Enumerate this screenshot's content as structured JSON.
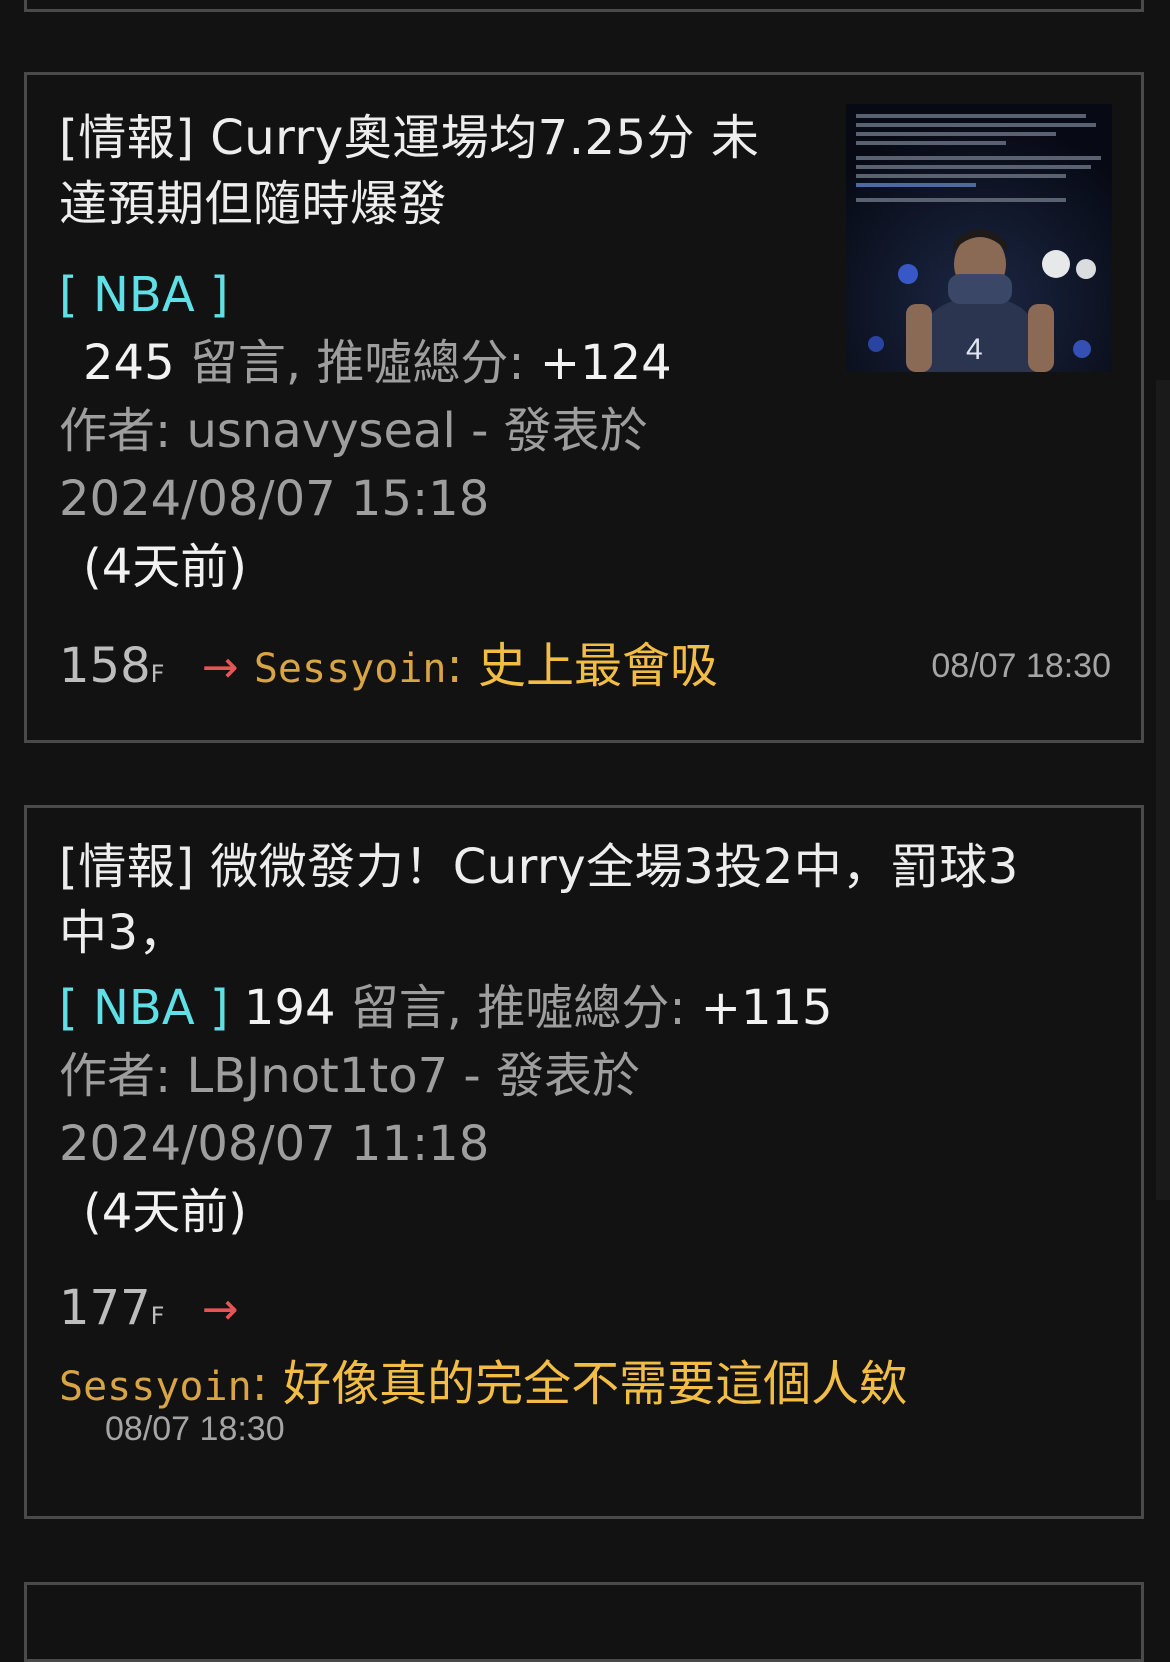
{
  "posts": [
    {
      "title_line1": "[情報] Curry奧運場均7.25分 未",
      "title_line2": "達預期但隨時爆發",
      "board": "[ NBA ]",
      "comment_count": "245",
      "comment_label": "留言, 推噓總分: ",
      "score": "+124",
      "author_label": "作者: ",
      "author": "usnavyseal",
      "posted_label": " - 發表於",
      "datetime": "2024/08/07 15:18",
      "relative": "(4天前)",
      "has_thumbnail": true,
      "push": {
        "floor": "158",
        "floor_suffix": "F",
        "arrow": "→",
        "user": "Sessyoin",
        "colon": ": ",
        "text": "史上最會吸",
        "time": "08/07 18:30"
      }
    },
    {
      "title_line1": "[情報] 微微發力！Curry全場3投2中，罰球3",
      "title_line2": "中3，",
      "board": "[ NBA ]",
      "comment_count": "194",
      "comment_label": "留言, 推噓總分: ",
      "score": "+115",
      "author_label": "作者: ",
      "author": "LBJnot1to7",
      "posted_label": " - 發表於",
      "datetime": "2024/08/07 11:18",
      "relative": "(4天前)",
      "has_thumbnail": false,
      "push": {
        "floor": "177",
        "floor_suffix": "F",
        "arrow": "→",
        "user": "Sessyoin",
        "colon": ": ",
        "text": "好像真的完全不需要這個人欸",
        "time": "08/07 18:30"
      }
    }
  ],
  "colors": {
    "background": "#121212",
    "border": "#4a4a4a",
    "board": "#5ee0e6",
    "arrow": "#e65555",
    "push_user": "#d9a444",
    "push_text": "#f2bd45",
    "meta": "#9e9e9e"
  },
  "icons": {
    "push_arrow": "arrow-right-icon"
  }
}
